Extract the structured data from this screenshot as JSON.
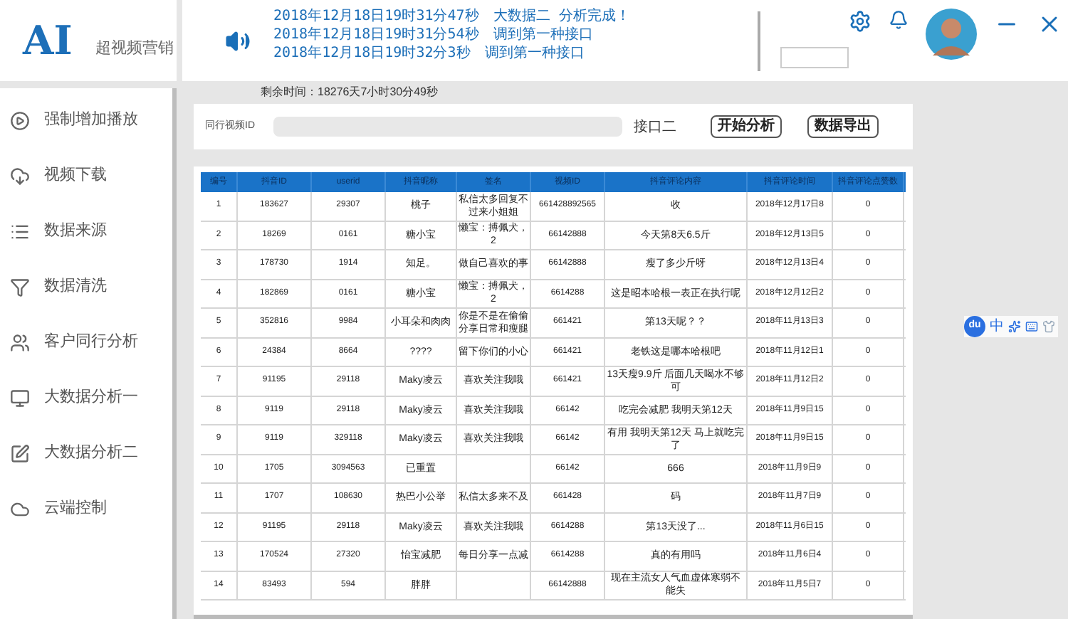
{
  "app": {
    "logo": "AI",
    "name": "超视频营销"
  },
  "log": [
    "2018年12月18日19时31分47秒　大数据二 分析完成！",
    "2018年12月18日19时31分54秒　调到第一种接口",
    "2018年12月18日19时32分3秒　调到第一种接口"
  ],
  "sidebar": {
    "items": [
      "强制增加播放",
      "视频下载",
      "数据来源",
      "数据清洗",
      "客户同行分析",
      "大数据分析一",
      "大数据分析二",
      "云端控制"
    ]
  },
  "remaining_time": "剩余时间：18276天7小时30分49秒",
  "search": {
    "label": "同行视频ID",
    "interface": "接口二",
    "buttons": [
      "开始分析",
      "数据导出"
    ]
  },
  "table": {
    "columns": [
      "编号",
      "抖音ID",
      "userid",
      "抖音昵称",
      "签名",
      "视频ID",
      "抖音评论内容",
      "抖音评论时间",
      "抖音评论点赞数"
    ],
    "rows": [
      [
        "1",
        "183627",
        "29307",
        "桃子",
        "私信太多回复不过来小姐姐",
        "661428892565",
        "收",
        "2018年12月17日8",
        "0"
      ],
      [
        "2",
        "18269",
        "0161",
        "糖小宝",
        "懒宝：搏佩犬，2",
        "66142888",
        "今天第8天6.5斤",
        "2018年12月13日5",
        "0"
      ],
      [
        "3",
        "178730",
        "1914",
        "知足。",
        "做自己喜欢的事",
        "66142888",
        "瘦了多少斤呀",
        "2018年12月13日4",
        "0"
      ],
      [
        "4",
        "182869",
        "0161",
        "糖小宝",
        "懒宝：搏佩犬，2",
        "6614288",
        "这是昭本哈根一表正在执行呢",
        "2018年12月12日2",
        "0"
      ],
      [
        "5",
        "352816",
        "9984",
        "小耳朵和肉肉",
        "你是不是在偷偷分享日常和瘦腿",
        "661421",
        "第13天呢？？",
        "2018年11月13日3",
        "0"
      ],
      [
        "6",
        "24384",
        "8664",
        "????",
        "留下你们的小心",
        "661421",
        "老铁这是哪本哈根吧",
        "2018年11月12日1",
        "0"
      ],
      [
        "7",
        "91195",
        "29118",
        "Maky凌云",
        "喜欢关注我哦",
        "661421",
        "13天瘦9.9斤 后面几天喝水不够可",
        "2018年11月12日2",
        "0"
      ],
      [
        "8",
        "9119",
        "29118",
        "Maky凌云",
        "喜欢关注我哦",
        "66142",
        "吃完会减肥 我明天第12天",
        "2018年11月9日15",
        "0"
      ],
      [
        "9",
        "9119",
        "329118",
        "Maky凌云",
        "喜欢关注我哦",
        "66142",
        "有用 我明天第12天 马上就吃完了",
        "2018年11月9日15",
        "0"
      ],
      [
        "10",
        "1705",
        "3094563",
        "已重置",
        "",
        "66142",
        "666",
        "2018年11月9日9",
        "0"
      ],
      [
        "11",
        "1707",
        "108630",
        "热巴小公举",
        "私信太多来不及",
        "661428",
        "码",
        "2018年11月7日9",
        "0"
      ],
      [
        "12",
        "91195",
        "29118",
        "Maky凌云",
        "喜欢关注我哦",
        "6614288",
        "第13天没了...",
        "2018年11月6日15",
        "0"
      ],
      [
        "13",
        "170524",
        "27320",
        "怡宝减肥",
        "每日分享一点减",
        "6614288",
        "真的有用吗",
        "2018年11月6日4",
        "0"
      ],
      [
        "14",
        "83493",
        "594",
        "胖胖",
        "",
        "66142888",
        "现在主流女人气血虚体寒弱不能失",
        "2018年11月5日7",
        "0"
      ]
    ]
  },
  "ime": {
    "logo": "du",
    "mode": "中"
  }
}
